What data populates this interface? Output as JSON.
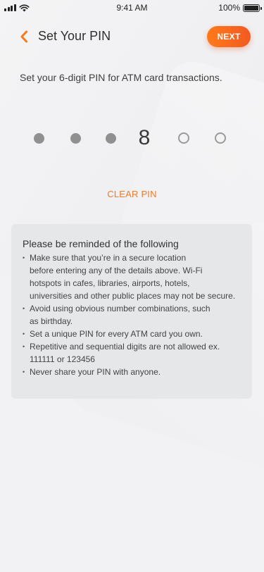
{
  "status_bar": {
    "time": "9:41 AM",
    "battery": "100%",
    "battery_level": 1.0,
    "icons": [
      "signal-icon",
      "wifi-icon",
      "battery-icon"
    ]
  },
  "header": {
    "title": "Set Your PIN",
    "next_label": "NEXT",
    "back_icon": "chevron-left-icon",
    "accent_color": "#f15a22"
  },
  "instruction": "Set your 6-digit PIN for ATM card transactions.",
  "pin": {
    "length": 6,
    "slots": [
      {
        "state": "filled",
        "value": ""
      },
      {
        "state": "filled",
        "value": ""
      },
      {
        "state": "filled",
        "value": ""
      },
      {
        "state": "digit",
        "value": "8"
      },
      {
        "state": "empty",
        "value": ""
      },
      {
        "state": "empty",
        "value": ""
      }
    ]
  },
  "clear_pin_label": "CLEAR PIN",
  "reminder": {
    "title": "Please be reminded of the following",
    "items": [
      [
        "Make sure that you’re in a  secure location",
        "before entering any of the details above. Wi-Fi",
        "hotspots in cafes, libraries, airports, hotels,",
        "universities and other public places may not be secure."
      ],
      [
        "Avoid using obvious number combinations, such",
        "as birthday."
      ],
      [
        "Set a unique PIN for every ATM card you own."
      ],
      [
        "Repetitive and sequential digits are not allowed ex.",
        "111111 or 123456"
      ],
      [
        "Never share your PIN with anyone."
      ]
    ]
  }
}
